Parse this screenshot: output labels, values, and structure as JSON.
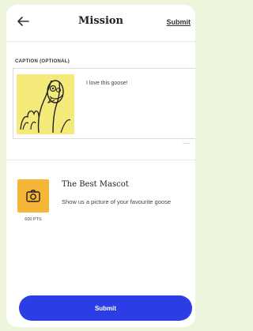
{
  "header": {
    "title": "Mission",
    "submit_label": "Submit"
  },
  "caption": {
    "label": "CAPTION (OPTIONAL)",
    "text": "I love this goose!",
    "counter": "——"
  },
  "mission": {
    "title": "The Best Mascot",
    "description": "Show us a picture of your favourite goose",
    "points": "600 PTS"
  },
  "footer": {
    "submit_button_label": "Submit"
  },
  "colors": {
    "page_bg": "#eef5dd",
    "accent": "#2b3de5",
    "mission_tile": "#f5b638",
    "photo_bg": "#f4ea7a"
  }
}
